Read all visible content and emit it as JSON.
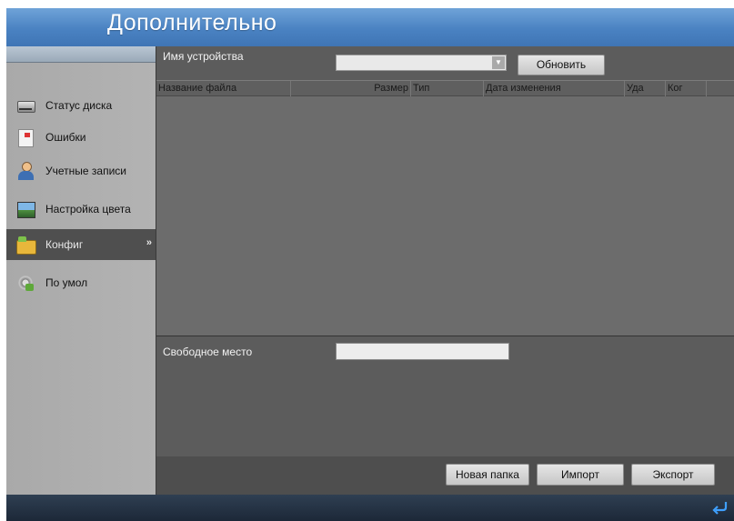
{
  "window": {
    "title": "Дополнительно"
  },
  "sidebar": {
    "items": [
      {
        "label": "Статус диска",
        "icon": "disk-icon"
      },
      {
        "label": "Ошибки",
        "icon": "error-log-icon"
      },
      {
        "label": "Учетные записи",
        "icon": "user-icon"
      },
      {
        "label": "Настройка цвета",
        "icon": "color-settings-icon"
      },
      {
        "label": "Конфиг",
        "icon": "config-folder-icon",
        "active": true,
        "arrow": "»"
      },
      {
        "label": "По умол",
        "icon": "default-settings-icon"
      }
    ]
  },
  "main": {
    "device_label": "Имя устройства",
    "device_value": "",
    "refresh_label": "Обновить",
    "columns": [
      "Название файла",
      "Размер",
      "Тип",
      "Дата изменения",
      "Уда",
      "Ког"
    ],
    "rows": [],
    "free_space_label": "Свободное место",
    "free_space_value": "",
    "new_folder_label": "Новая папка",
    "import_label": "Импорт",
    "export_label": "Экспорт"
  },
  "colors": {
    "title_bar": "#4a82c2",
    "panel": "#5c5c5c",
    "sidebar": "#adadad",
    "footer": "#1c2838"
  }
}
